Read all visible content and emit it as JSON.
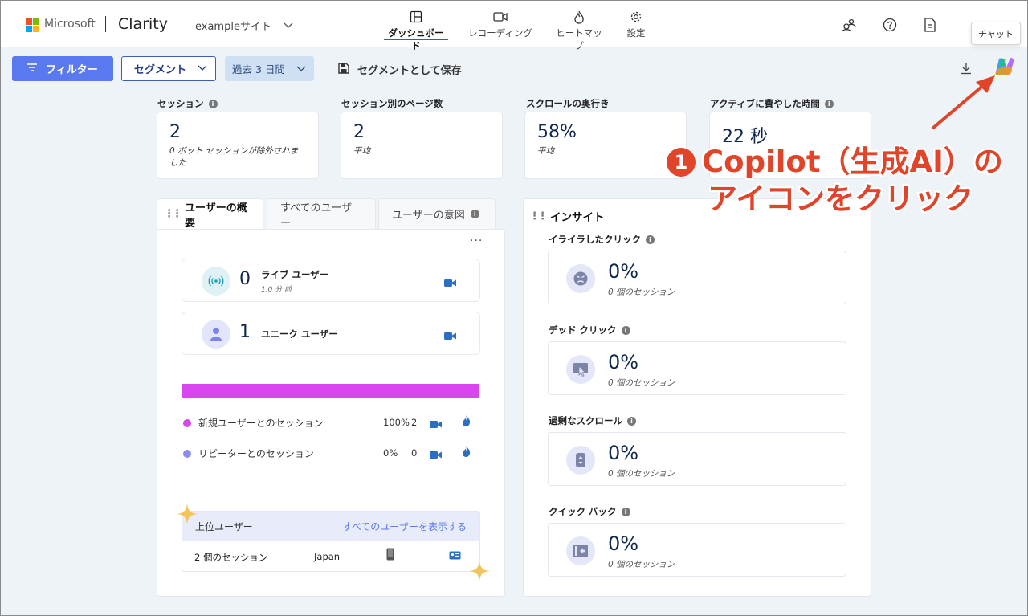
{
  "header": {
    "ms_name": "Microsoft",
    "brand": "Clarity",
    "site": "exampleサイト",
    "tabs": [
      {
        "label": "ダッシュボード",
        "icon": "dashboard-icon",
        "active": true
      },
      {
        "label": "レコーディング",
        "icon": "recording-icon",
        "active": false
      },
      {
        "label": "ヒートマップ",
        "icon": "heatmap-icon",
        "active": false
      },
      {
        "label": "設定",
        "icon": "gear-icon",
        "active": false
      }
    ],
    "tooltip": "チャット"
  },
  "toolbar": {
    "filter": "フィルター",
    "segment": "セグメント",
    "date_range": "過去 3 日間",
    "save_segment": "セグメントとして保存"
  },
  "metrics": [
    {
      "label": "セッション",
      "value": "2",
      "sub": "0 ボット セッションが除外されました"
    },
    {
      "label": "セッション別のページ数",
      "value": "2",
      "sub": "平均"
    },
    {
      "label": "スクロールの奥行き",
      "value": "58%",
      "sub": "平均"
    },
    {
      "label": "アクティブに費やした時間",
      "value": "22 秒",
      "sub": ""
    }
  ],
  "callout": {
    "number": "1",
    "line1": "Copilot（生成AI）の",
    "line2": "アイコンをクリック",
    "color": "#e0452a"
  },
  "user_panel": {
    "tabs": [
      "ユーザーの概要",
      "すべてのユーザー",
      "ユーザーの意図"
    ],
    "live": {
      "count": "0",
      "label": "ライブ ユーザー",
      "sub": "1.0 分 前"
    },
    "unique": {
      "count": "1",
      "label": "ユニーク ユーザー"
    },
    "legend": [
      {
        "label": "新規ユーザーとのセッション",
        "pct": "100%",
        "count": "2",
        "color": "#d946ef"
      },
      {
        "label": "リピーターとのセッション",
        "pct": "0%",
        "count": "0",
        "color": "#8b8cf0"
      }
    ],
    "new_share": 1.0,
    "top_users": {
      "title": "上位ユーザー",
      "link": "すべてのユーザーを表示する",
      "row": {
        "sessions": "2 個のセッション",
        "country": "Japan"
      }
    }
  },
  "insights": {
    "title": "インサイト",
    "items": [
      {
        "label": "イライラしたクリック",
        "value": "0%",
        "sub": "0 個のセッション",
        "icon": "angry-face-icon"
      },
      {
        "label": "デッド クリック",
        "value": "0%",
        "sub": "0 個のセッション",
        "icon": "dead-click-icon"
      },
      {
        "label": "過剰なスクロール",
        "value": "0%",
        "sub": "0 個のセッション",
        "icon": "scroll-icon"
      },
      {
        "label": "クイック バック",
        "value": "0%",
        "sub": "0 個のセッション",
        "icon": "quick-back-icon"
      }
    ]
  }
}
